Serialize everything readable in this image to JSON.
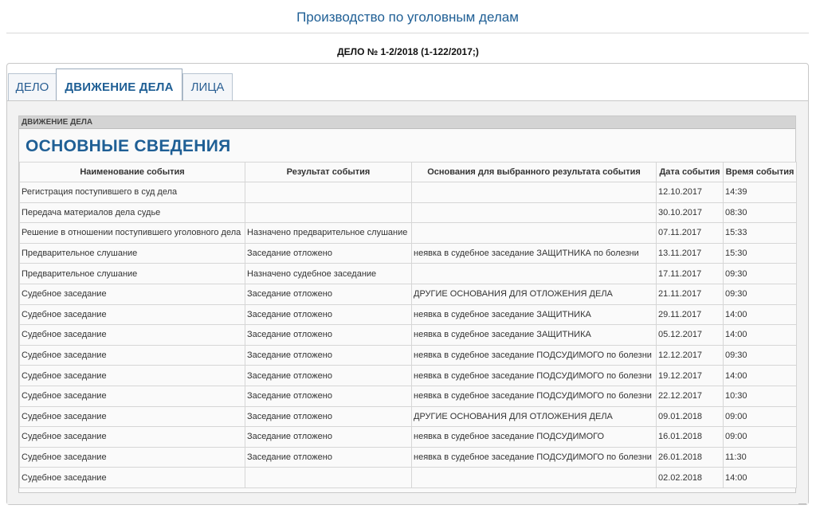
{
  "header": {
    "title": "Производство по уголовным делам"
  },
  "case": {
    "number": "ДЕЛО № 1-2/2018 (1-122/2017;)"
  },
  "tabs": [
    {
      "label": "ДЕЛО",
      "active": false
    },
    {
      "label": "ДВИЖЕНИЕ ДЕЛА",
      "active": true
    },
    {
      "label": "ЛИЦА",
      "active": false
    }
  ],
  "section": {
    "label": "ДВИЖЕНИЕ ДЕЛА",
    "title": "ОСНОВНЫЕ СВЕДЕНИЯ"
  },
  "table": {
    "columns": [
      "Наименование события",
      "Результат события",
      "Основания для выбранного результата события",
      "Дата события",
      "Время события"
    ],
    "rows": [
      [
        "Регистрация поступившего в суд дела",
        "",
        "",
        "12.10.2017",
        "14:39"
      ],
      [
        "Передача материалов дела судье",
        "",
        "",
        "30.10.2017",
        "08:30"
      ],
      [
        "Решение в отношении поступившего уголовного дела",
        "Назначено предварительное слушание",
        "",
        "07.11.2017",
        "15:33"
      ],
      [
        "Предварительное слушание",
        "Заседание отложено",
        "неявка в судебное заседание ЗАЩИТНИКА по болезни",
        "13.11.2017",
        "15:30"
      ],
      [
        "Предварительное слушание",
        "Назначено судебное заседание",
        "",
        "17.11.2017",
        "09:30"
      ],
      [
        "Судебное заседание",
        "Заседание отложено",
        "ДРУГИЕ ОСНОВАНИЯ ДЛЯ ОТЛОЖЕНИЯ ДЕЛА",
        "21.11.2017",
        "09:30"
      ],
      [
        "Судебное заседание",
        "Заседание отложено",
        "неявка в судебное заседание ЗАЩИТНИКА",
        "29.11.2017",
        "14:00"
      ],
      [
        "Судебное заседание",
        "Заседание отложено",
        "неявка в судебное заседание ЗАЩИТНИКА",
        "05.12.2017",
        "14:00"
      ],
      [
        "Судебное заседание",
        "Заседание отложено",
        "неявка в судебное заседание ПОДСУДИМОГО по болезни",
        "12.12.2017",
        "09:30"
      ],
      [
        "Судебное заседание",
        "Заседание отложено",
        "неявка в судебное заседание ПОДСУДИМОГО по болезни",
        "19.12.2017",
        "14:00"
      ],
      [
        "Судебное заседание",
        "Заседание отложено",
        "неявка в судебное заседание ПОДСУДИМОГО по болезни",
        "22.12.2017",
        "10:30"
      ],
      [
        "Судебное заседание",
        "Заседание отложено",
        "ДРУГИЕ ОСНОВАНИЯ ДЛЯ ОТЛОЖЕНИЯ ДЕЛА",
        "09.01.2018",
        "09:00"
      ],
      [
        "Судебное заседание",
        "Заседание отложено",
        "неявка в судебное заседание ПОДСУДИМОГО",
        "16.01.2018",
        "09:00"
      ],
      [
        "Судебное заседание",
        "Заседание отложено",
        "неявка в судебное заседание ПОДСУДИМОГО по болезни",
        "26.01.2018",
        "11:30"
      ],
      [
        "Судебное заседание",
        "",
        "",
        "02.02.2018",
        "14:00"
      ]
    ]
  }
}
